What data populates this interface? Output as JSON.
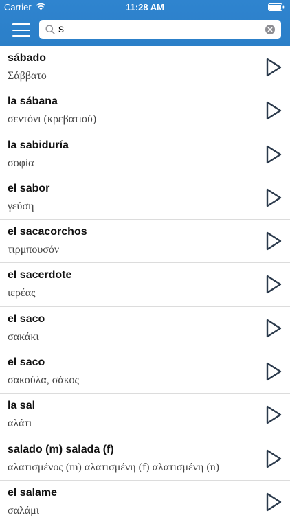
{
  "status_bar": {
    "carrier": "Carrier",
    "time": "11:28 AM"
  },
  "search": {
    "value": "s",
    "placeholder": ""
  },
  "icons": {
    "menu": "hamburger-menu-icon",
    "search": "search-icon",
    "clear": "clear-icon",
    "play": "play-icon"
  },
  "colors": {
    "header": "#2f84cf",
    "play_stroke": "#2b3a4c"
  },
  "entries": [
    {
      "word": "sábado",
      "translation": "Σάββατο"
    },
    {
      "word": "la sábana",
      "translation": "σεντόνι (κρεβατιού)"
    },
    {
      "word": "la sabiduría",
      "translation": "σοφία"
    },
    {
      "word": "el sabor",
      "translation": "γεύση"
    },
    {
      "word": "el sacacorchos",
      "translation": "τιρμπουσόν"
    },
    {
      "word": "el sacerdote",
      "translation": "ιερέας"
    },
    {
      "word": "el saco",
      "translation": "σακάκι"
    },
    {
      "word": "el saco",
      "translation": "σακούλα, σάκος"
    },
    {
      "word": "la sal",
      "translation": "αλάτι"
    },
    {
      "word": "salado (m)  salada (f)",
      "translation": "αλατισμένος (m)  αλατισμένη (f)  αλατισμένη (n)"
    },
    {
      "word": "el salame",
      "translation": "σαλάμι"
    }
  ]
}
